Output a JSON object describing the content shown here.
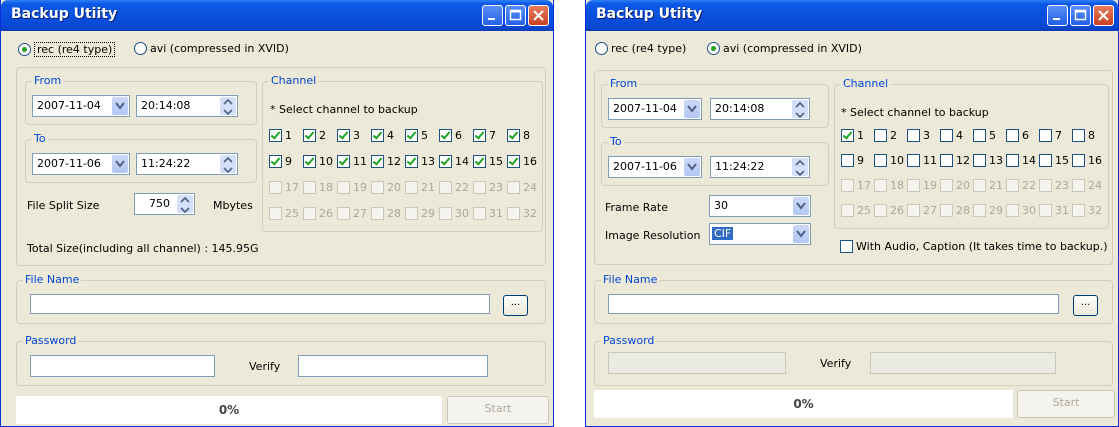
{
  "left": {
    "title": "Backup Utiity",
    "format": {
      "rec_label": "rec (re4 type)",
      "avi_label": "avi (compressed in XVID)",
      "selected": "rec"
    },
    "from": {
      "label": "From",
      "date": "2007-11-04",
      "time": "20:14:08"
    },
    "to": {
      "label": "To",
      "date": "2007-11-06",
      "time": "11:24:22"
    },
    "split": {
      "label": "File Split Size",
      "value": "750",
      "unit": "Mbytes"
    },
    "total": "Total Size(including all channel) : 145.95G",
    "channel": {
      "label": "Channel",
      "hint": "* Select channel to backup",
      "checked": [
        1,
        2,
        3,
        4,
        5,
        6,
        7,
        8,
        9,
        10,
        11,
        12,
        13,
        14,
        15,
        16
      ]
    },
    "file": {
      "label": "File Name",
      "value": "",
      "browse": "..."
    },
    "password": {
      "label": "Password",
      "verify_label": "Verify"
    },
    "progress": "0%",
    "start": "Start"
  },
  "right": {
    "title": "Backup Utiity",
    "format": {
      "rec_label": "rec (re4 type)",
      "avi_label": "avi (compressed in XVID)",
      "selected": "avi"
    },
    "from": {
      "label": "From",
      "date": "2007-11-04",
      "time": "20:14:08"
    },
    "to": {
      "label": "To",
      "date": "2007-11-06",
      "time": "11:24:22"
    },
    "frame_rate": {
      "label": "Frame Rate",
      "value": "30"
    },
    "resolution": {
      "label": "Image Resolution",
      "value": "CIF"
    },
    "channel": {
      "label": "Channel",
      "hint": "* Select channel to backup",
      "checked": [
        1
      ]
    },
    "audio": {
      "label": "With Audio, Caption (It takes time to backup.)",
      "checked": false
    },
    "file": {
      "label": "File Name",
      "value": "",
      "browse": "..."
    },
    "password": {
      "label": "Password",
      "verify_label": "Verify"
    },
    "progress": "0%",
    "start": "Start"
  },
  "channels": [
    "1",
    "2",
    "3",
    "4",
    "5",
    "6",
    "7",
    "8",
    "9",
    "10",
    "11",
    "12",
    "13",
    "14",
    "15",
    "16",
    "17",
    "18",
    "19",
    "20",
    "21",
    "22",
    "23",
    "24",
    "25",
    "26",
    "27",
    "28",
    "29",
    "30",
    "31",
    "32"
  ],
  "enabled_channels_max": 16,
  "colors": {
    "title_bar": "#0a4fdc",
    "group_label": "#0046d5",
    "dialog_bg": "#ece9d8",
    "check": "#21a121"
  }
}
